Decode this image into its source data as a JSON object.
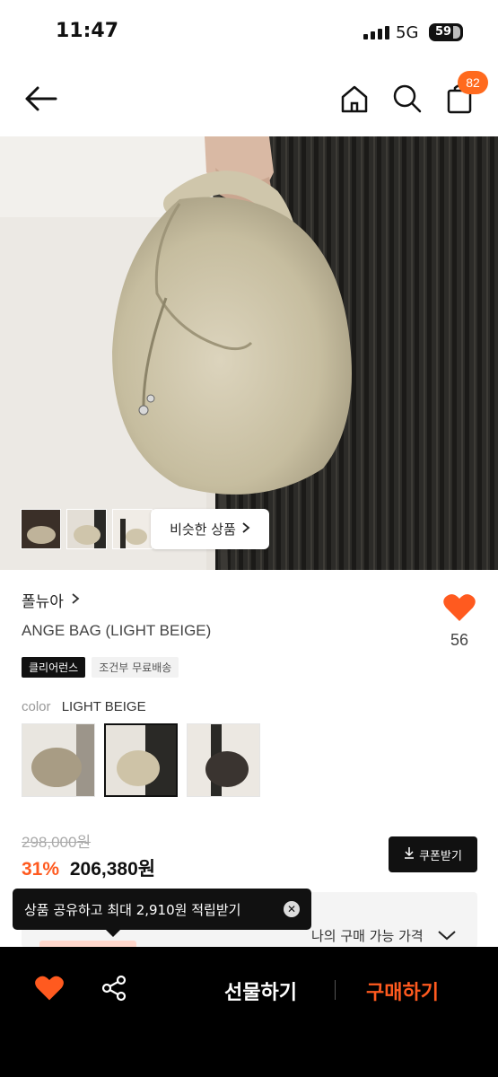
{
  "status": {
    "time": "11:47",
    "network": "5G",
    "battery": "59"
  },
  "nav": {
    "cart_count": "82"
  },
  "hero": {
    "similar_label": "비슷한 상품"
  },
  "product": {
    "brand": "폴뉴아",
    "name": "ANGE BAG (LIGHT BEIGE)",
    "like_count": "56",
    "tags": [
      "클리어런스",
      "조건부 무료배송"
    ],
    "color_label": "color",
    "color_value": "LIGHT BEIGE",
    "original_price": "298,000원",
    "discount": "31%",
    "price": "206,380원",
    "coupon_label": "쿠폰받기",
    "my_price_label": "나의 구매 가능 가격"
  },
  "tooltip": {
    "text": "상품 공유하고 최대 2,910원 적립받기"
  },
  "bottom": {
    "gift_label": "선물하기",
    "buy_label": "구매하기"
  },
  "colors": {
    "accent": "#ff5a1f",
    "badge": "#ff6a1e"
  }
}
